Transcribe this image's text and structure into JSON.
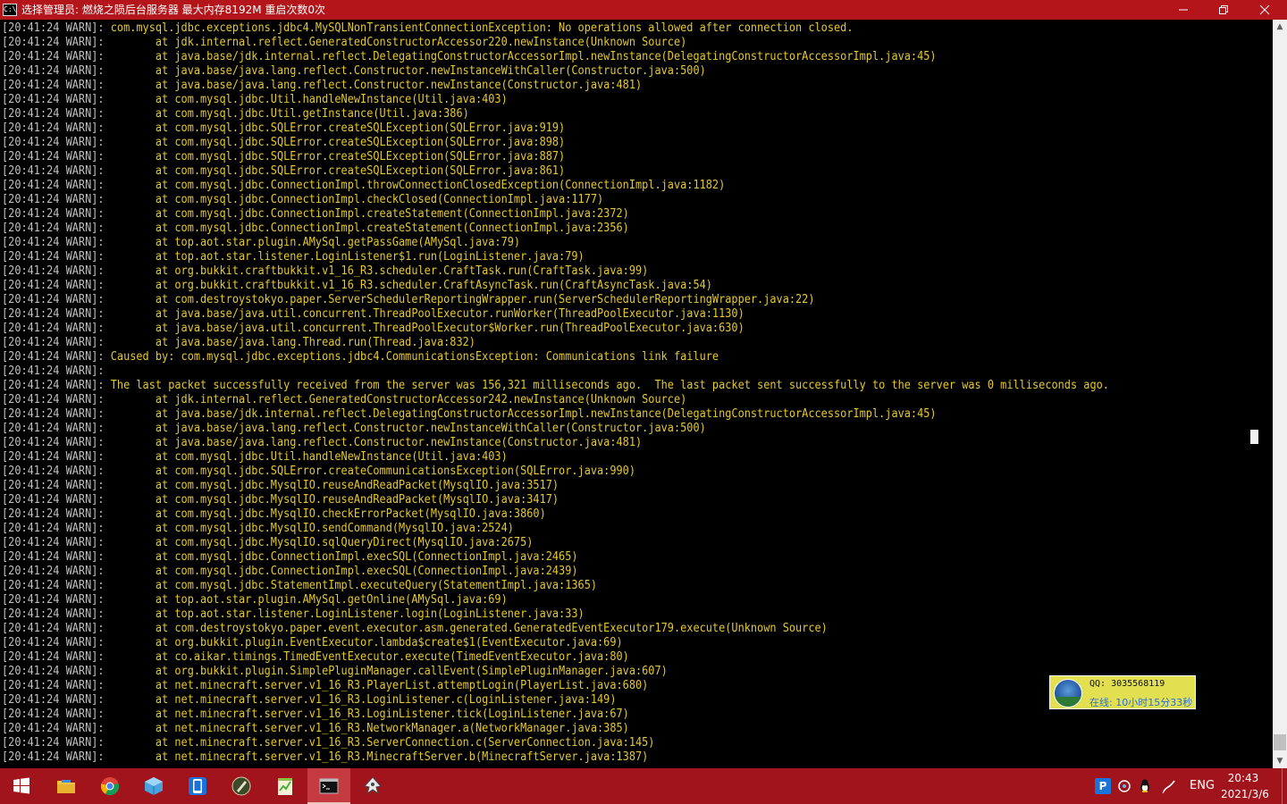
{
  "window": {
    "icon_text": "C:\\",
    "title": "选择管理员:  燃烧之陨后台服务器 最大内存8192M 重启次数0次"
  },
  "console": {
    "prefix": "[20:41:24 WARN]: ",
    "lines": [
      "com.mysql.jdbc.exceptions.jdbc4.MySQLNonTransientConnectionException: No operations allowed after connection closed.",
      "\tat jdk.internal.reflect.GeneratedConstructorAccessor220.newInstance(Unknown Source)",
      "\tat java.base/jdk.internal.reflect.DelegatingConstructorAccessorImpl.newInstance(DelegatingConstructorAccessorImpl.java:45)",
      "\tat java.base/java.lang.reflect.Constructor.newInstanceWithCaller(Constructor.java:500)",
      "\tat java.base/java.lang.reflect.Constructor.newInstance(Constructor.java:481)",
      "\tat com.mysql.jdbc.Util.handleNewInstance(Util.java:403)",
      "\tat com.mysql.jdbc.Util.getInstance(Util.java:386)",
      "\tat com.mysql.jdbc.SQLError.createSQLException(SQLError.java:919)",
      "\tat com.mysql.jdbc.SQLError.createSQLException(SQLError.java:898)",
      "\tat com.mysql.jdbc.SQLError.createSQLException(SQLError.java:887)",
      "\tat com.mysql.jdbc.SQLError.createSQLException(SQLError.java:861)",
      "\tat com.mysql.jdbc.ConnectionImpl.throwConnectionClosedException(ConnectionImpl.java:1182)",
      "\tat com.mysql.jdbc.ConnectionImpl.checkClosed(ConnectionImpl.java:1177)",
      "\tat com.mysql.jdbc.ConnectionImpl.createStatement(ConnectionImpl.java:2372)",
      "\tat com.mysql.jdbc.ConnectionImpl.createStatement(ConnectionImpl.java:2356)",
      "\tat top.aot.star.plugin.AMySql.getPassGame(AMySql.java:79)",
      "\tat top.aot.star.listener.LoginListener$1.run(LoginListener.java:79)",
      "\tat org.bukkit.craftbukkit.v1_16_R3.scheduler.CraftTask.run(CraftTask.java:99)",
      "\tat org.bukkit.craftbukkit.v1_16_R3.scheduler.CraftAsyncTask.run(CraftAsyncTask.java:54)",
      "\tat com.destroystokyo.paper.ServerSchedulerReportingWrapper.run(ServerSchedulerReportingWrapper.java:22)",
      "\tat java.base/java.util.concurrent.ThreadPoolExecutor.runWorker(ThreadPoolExecutor.java:1130)",
      "\tat java.base/java.util.concurrent.ThreadPoolExecutor$Worker.run(ThreadPoolExecutor.java:630)",
      "\tat java.base/java.lang.Thread.run(Thread.java:832)",
      "Caused by: com.mysql.jdbc.exceptions.jdbc4.CommunicationsException: Communications link failure",
      "",
      "The last packet successfully received from the server was 156,321 milliseconds ago.  The last packet sent successfully to the server was 0 milliseconds ago.",
      "\tat jdk.internal.reflect.GeneratedConstructorAccessor242.newInstance(Unknown Source)",
      "\tat java.base/jdk.internal.reflect.DelegatingConstructorAccessorImpl.newInstance(DelegatingConstructorAccessorImpl.java:45)",
      "\tat java.base/java.lang.reflect.Constructor.newInstanceWithCaller(Constructor.java:500)",
      "\tat java.base/java.lang.reflect.Constructor.newInstance(Constructor.java:481)",
      "\tat com.mysql.jdbc.Util.handleNewInstance(Util.java:403)",
      "\tat com.mysql.jdbc.SQLError.createCommunicationsException(SQLError.java:990)",
      "\tat com.mysql.jdbc.MysqlIO.reuseAndReadPacket(MysqlIO.java:3517)",
      "\tat com.mysql.jdbc.MysqlIO.reuseAndReadPacket(MysqlIO.java:3417)",
      "\tat com.mysql.jdbc.MysqlIO.checkErrorPacket(MysqlIO.java:3860)",
      "\tat com.mysql.jdbc.MysqlIO.sendCommand(MysqlIO.java:2524)",
      "\tat com.mysql.jdbc.MysqlIO.sqlQueryDirect(MysqlIO.java:2675)",
      "\tat com.mysql.jdbc.ConnectionImpl.execSQL(ConnectionImpl.java:2465)",
      "\tat com.mysql.jdbc.ConnectionImpl.execSQL(ConnectionImpl.java:2439)",
      "\tat com.mysql.jdbc.StatementImpl.executeQuery(StatementImpl.java:1365)",
      "\tat top.aot.star.plugin.AMySql.getOnline(AMySql.java:69)",
      "\tat top.aot.star.listener.LoginListener.login(LoginListener.java:33)",
      "\tat com.destroystokyo.paper.event.executor.asm.generated.GeneratedEventExecutor179.execute(Unknown Source)",
      "\tat org.bukkit.plugin.EventExecutor.lambda$create$1(EventExecutor.java:69)",
      "\tat co.aikar.timings.TimedEventExecutor.execute(TimedEventExecutor.java:80)",
      "\tat org.bukkit.plugin.SimplePluginManager.callEvent(SimplePluginManager.java:607)",
      "\tat net.minecraft.server.v1_16_R3.PlayerList.attemptLogin(PlayerList.java:680)",
      "\tat net.minecraft.server.v1_16_R3.LoginListener.c(LoginListener.java:149)",
      "\tat net.minecraft.server.v1_16_R3.LoginListener.tick(LoginListener.java:67)",
      "\tat net.minecraft.server.v1_16_R3.NetworkManager.a(NetworkManager.java:385)",
      "\tat net.minecraft.server.v1_16_R3.ServerConnection.c(ServerConnection.java:145)",
      "\tat net.minecraft.server.v1_16_R3.MinecraftServer.b(MinecraftServer.java:1387)"
    ]
  },
  "qq_popup": {
    "qq_number": "QQ: 3035568119",
    "online_time": "在线: 10小时15分33秒"
  },
  "taskbar": {
    "apps": [
      "start",
      "file-explorer",
      "chrome",
      "network-tool",
      "phone-app",
      "minecraft-launcher",
      "notepad-plus",
      "command-prompt",
      "inkscape"
    ],
    "tray_icons": [
      "p-app-icon",
      "qq-icon",
      "penguin-icon",
      "pen-icon"
    ],
    "ime": "ENG",
    "time": "20:43",
    "date": "2021/3/6"
  },
  "colors": {
    "titlebar": "#b3151a",
    "taskbar": "#a2141c",
    "console_text": "#c0c0c0",
    "message_text": "#e6c92b",
    "qq_popup_bg": "#e2e050"
  }
}
